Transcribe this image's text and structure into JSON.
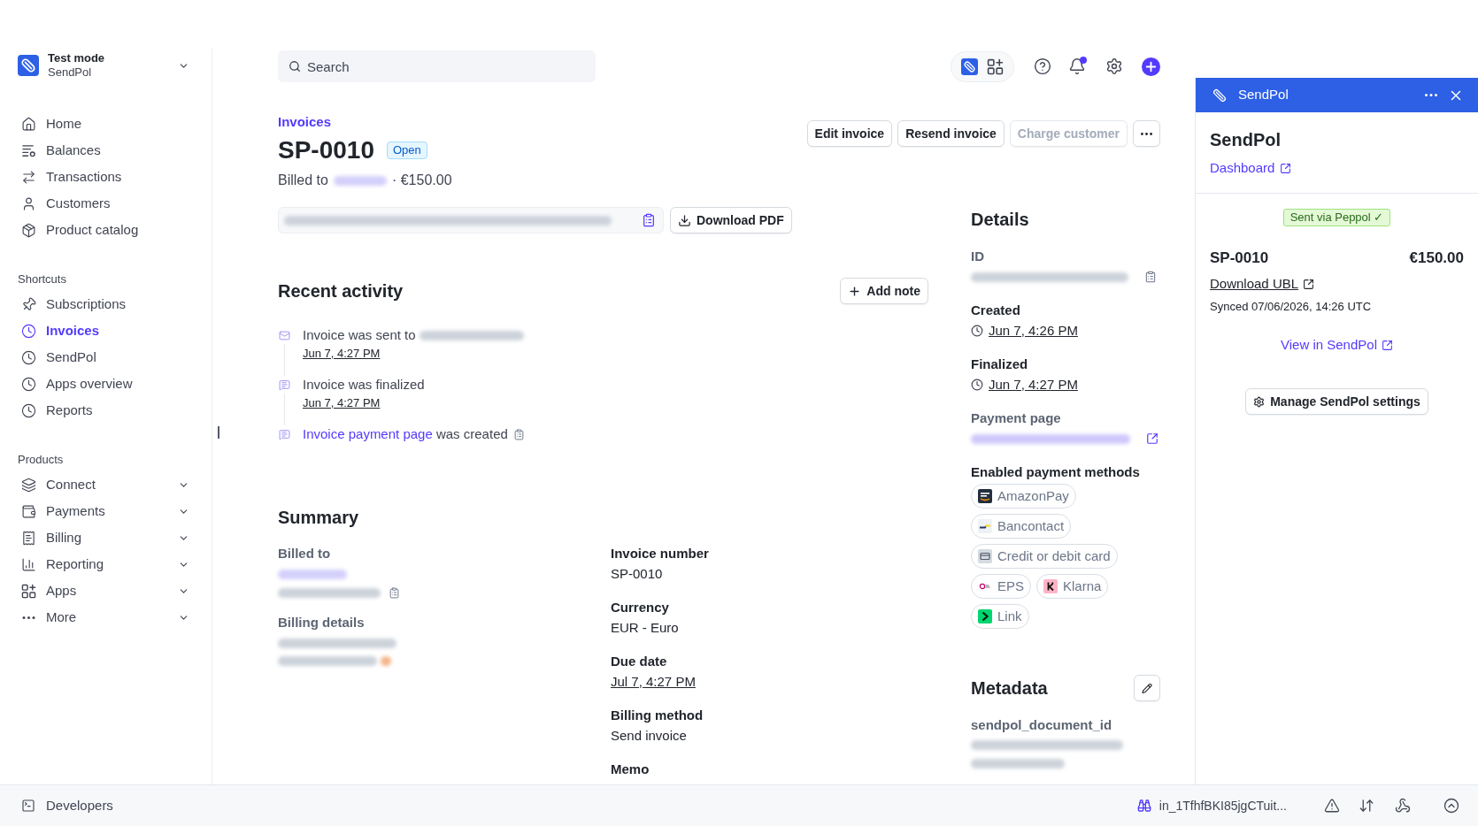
{
  "account": {
    "mode": "Test mode",
    "name": "SendPol"
  },
  "sidebar": {
    "items": [
      {
        "label": "Home",
        "selected": false
      },
      {
        "label": "Balances",
        "selected": false
      },
      {
        "label": "Transactions",
        "selected": false
      },
      {
        "label": "Customers",
        "selected": false
      },
      {
        "label": "Product catalog",
        "selected": false
      }
    ],
    "sections": [
      {
        "title": "Shortcuts",
        "items": [
          {
            "label": "Subscriptions",
            "selected": false
          },
          {
            "label": "Invoices",
            "selected": true
          },
          {
            "label": "SendPol",
            "selected": false
          },
          {
            "label": "Apps overview",
            "selected": false
          },
          {
            "label": "Reports",
            "selected": false
          }
        ]
      },
      {
        "title": "Products",
        "items": [
          {
            "label": "Connect",
            "selected": false,
            "expanded": false
          },
          {
            "label": "Payments",
            "selected": false,
            "expanded": false
          },
          {
            "label": "Billing",
            "selected": false,
            "expanded": false
          },
          {
            "label": "Reporting",
            "selected": false,
            "expanded": false
          },
          {
            "label": "Apps",
            "selected": false,
            "expanded": false
          },
          {
            "label": "More",
            "selected": false,
            "expanded": false
          }
        ]
      }
    ]
  },
  "search": {
    "placeholder": "Search"
  },
  "invoice": {
    "breadcrumb": "Invoices",
    "number": "SP-0010",
    "status": "Open",
    "billed_to": "Billed to",
    "amount": "· €150.00"
  },
  "actions": [
    {
      "label": "Edit invoice",
      "disabled": false
    },
    {
      "label": "Resend invoice",
      "disabled": false
    },
    {
      "label": "Charge customer",
      "disabled": true
    }
  ],
  "download_button": "Download PDF",
  "recent_activity": {
    "title": "Recent activity",
    "add_button": "Add note",
    "items": [
      {
        "kind": "sent",
        "text": "Invoice was sent to",
        "time": "Jun 7, 4:27 PM"
      },
      {
        "kind": "finalized",
        "text": "Invoice was finalized",
        "time": "Jun 7, 4:27 PM"
      },
      {
        "kind": "created",
        "link": "Invoice payment page",
        "text": "was created"
      }
    ]
  },
  "summary": {
    "title": "Summary",
    "billed_to_label": "Billed to",
    "billing_details_label": "Billing details",
    "fields": [
      {
        "kind": "text",
        "label": "Invoice number",
        "value": "SP-0010"
      },
      {
        "kind": "text",
        "label": "Currency",
        "value": "EUR - Euro"
      },
      {
        "kind": "date",
        "label": "Due date",
        "value": "Jul 7, 4:27 PM"
      },
      {
        "kind": "text",
        "label": "Billing method",
        "value": "Send invoice"
      },
      {
        "kind": "empty",
        "label": "Memo"
      }
    ]
  },
  "details": {
    "title": "Details",
    "fields": [
      {
        "kind": "redacted_copy",
        "label": "ID"
      },
      {
        "kind": "date",
        "label": "Created",
        "value": "Jun 7, 4:26 PM"
      },
      {
        "kind": "date",
        "label": "Finalized",
        "value": "Jun 7, 4:27 PM"
      },
      {
        "kind": "redacted_link",
        "label": "Payment page"
      }
    ],
    "payment_methods_label": "Enabled payment methods",
    "payment_methods": [
      "AmazonPay",
      "Bancontact",
      "Credit or debit card",
      "EPS",
      "Klarna",
      "Link"
    ]
  },
  "metadata": {
    "title": "Metadata",
    "key": "sendpol_document_id"
  },
  "app_panel": {
    "header_title": "SendPol",
    "title": "SendPol",
    "dashboard_link": "Dashboard",
    "badge": "Sent via Peppol ✓",
    "invoice_number": "SP-0010",
    "amount": "€150.00",
    "download_link": "Download UBL",
    "synced": "Synced 07/06/2026, 14:26 UTC",
    "view_link": "View in SendPol",
    "settings_button": "Manage SendPol settings"
  },
  "status_bar": {
    "developers": "Developers",
    "object_id": "in_1TfhfBKI85jgCTuit..."
  }
}
